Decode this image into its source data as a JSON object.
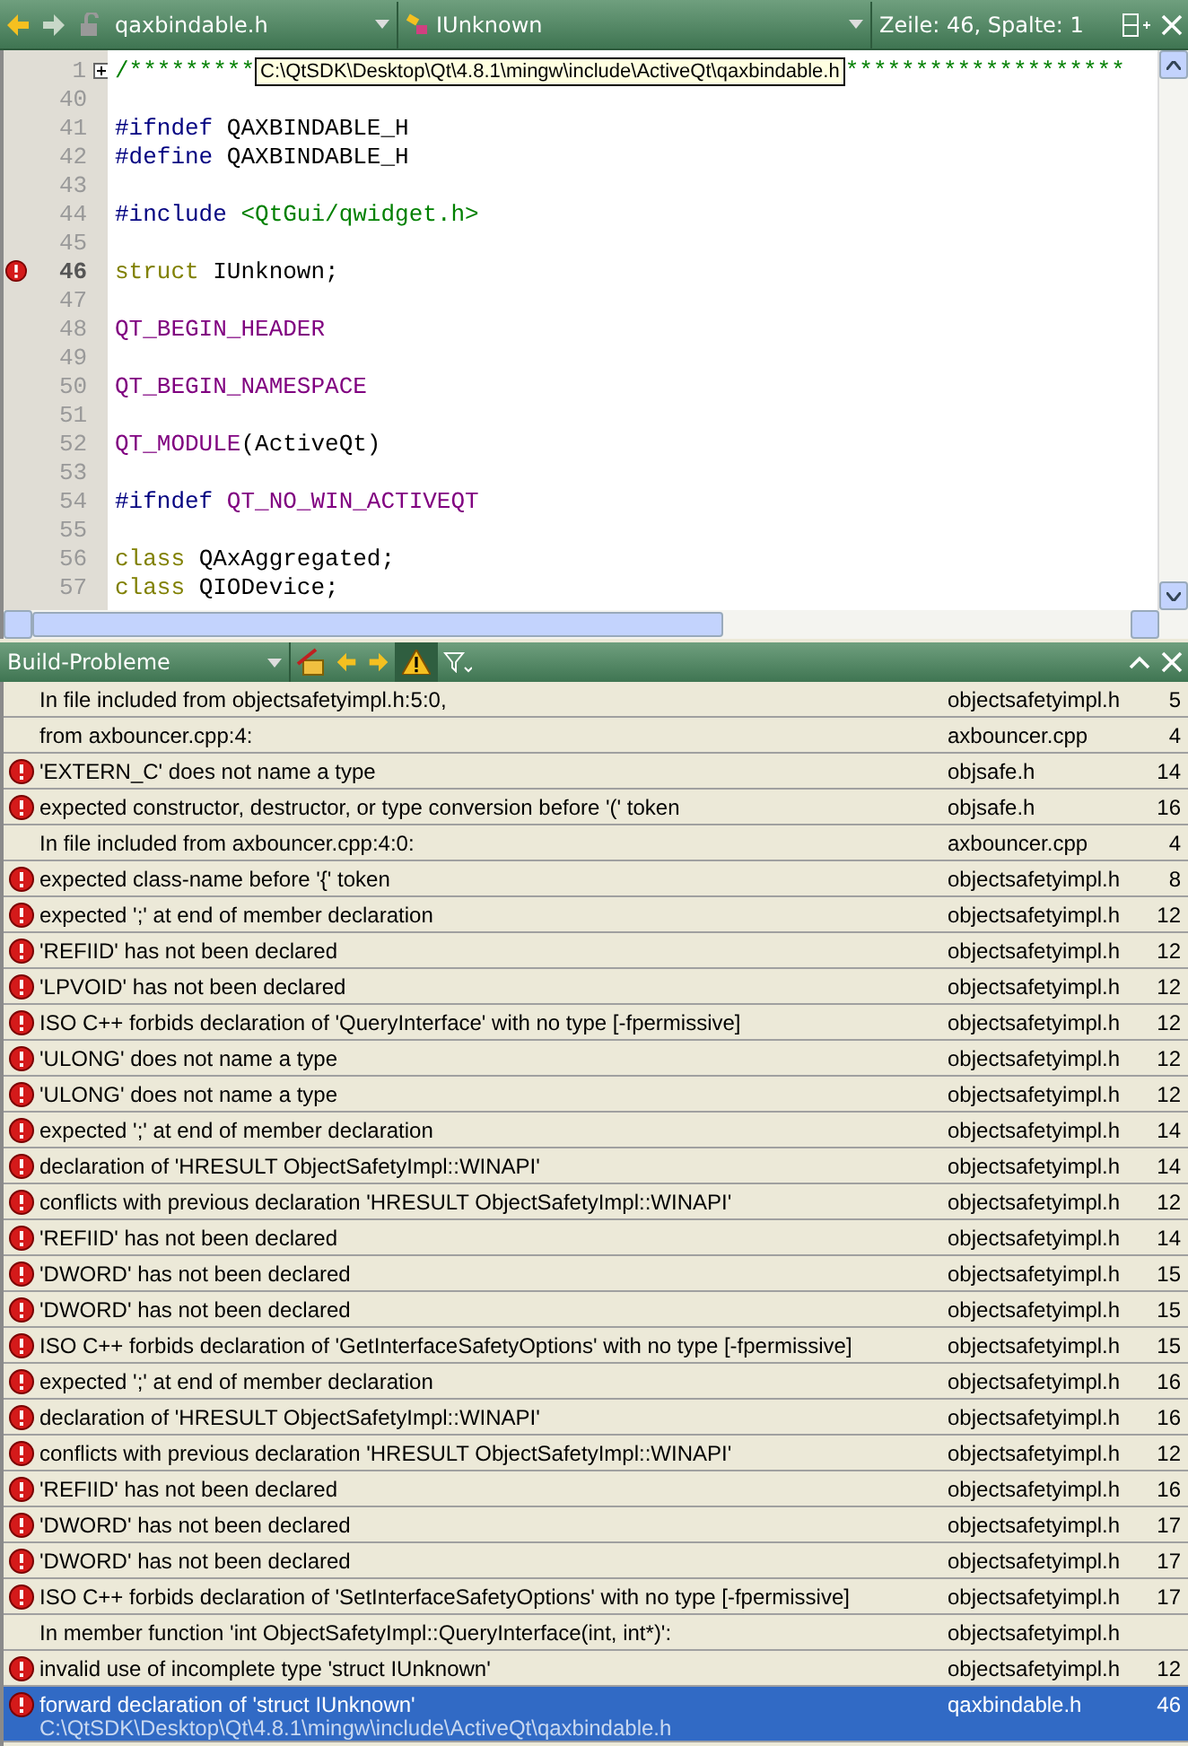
{
  "editor_toolbar": {
    "file": "qaxbindable.h",
    "symbol": "IUnknown",
    "position": "Zeile: 46, Spalte: 1"
  },
  "tooltip": "C:\\QtSDK\\Desktop\\Qt\\4.8.1\\mingw\\include\\ActiveQt\\qaxbindable.h",
  "code_lines": [
    {
      "number": "1",
      "fold": true,
      "tokens": [
        {
          "kind": "comment",
          "text": "/*********"
        }
      ],
      "tail": "********************"
    },
    {
      "number": "40"
    },
    {
      "number": "41",
      "tokens": [
        {
          "kind": "preprocessor",
          "text": "#ifndef"
        },
        {
          "kind": "plain",
          "text": " QAXBINDABLE_H"
        }
      ]
    },
    {
      "number": "42",
      "tokens": [
        {
          "kind": "preprocessor",
          "text": "#define"
        },
        {
          "kind": "plain",
          "text": " QAXBINDABLE_H"
        }
      ]
    },
    {
      "number": "43"
    },
    {
      "number": "44",
      "tokens": [
        {
          "kind": "preprocessor",
          "text": "#include"
        },
        {
          "kind": "string",
          "text": " <QtGui/qwidget.h>"
        }
      ]
    },
    {
      "number": "45"
    },
    {
      "number": "46",
      "error": true,
      "tokens": [
        {
          "kind": "keyword",
          "text": "struct"
        },
        {
          "kind": "plain",
          "text": " IUnknown;"
        }
      ]
    },
    {
      "number": "47"
    },
    {
      "number": "48",
      "tokens": [
        {
          "kind": "macro",
          "text": "QT_BEGIN_HEADER"
        }
      ]
    },
    {
      "number": "49"
    },
    {
      "number": "50",
      "tokens": [
        {
          "kind": "macro",
          "text": "QT_BEGIN_NAMESPACE"
        }
      ]
    },
    {
      "number": "51"
    },
    {
      "number": "52",
      "tokens": [
        {
          "kind": "macro",
          "text": "QT_MODULE"
        },
        {
          "kind": "plain",
          "text": "(ActiveQt)"
        }
      ]
    },
    {
      "number": "53"
    },
    {
      "number": "54",
      "tokens": [
        {
          "kind": "preprocessor",
          "text": "#ifndef"
        },
        {
          "kind": "macro",
          "text": " QT_NO_WIN_ACTIVEQT"
        }
      ]
    },
    {
      "number": "55"
    },
    {
      "number": "56",
      "tokens": [
        {
          "kind": "keyword",
          "text": "class"
        },
        {
          "kind": "plain",
          "text": " QAxAggregated;"
        }
      ]
    },
    {
      "number": "57",
      "tokens": [
        {
          "kind": "keyword",
          "text": "class"
        },
        {
          "kind": "plain",
          "text": " QIODevice;"
        }
      ]
    }
  ],
  "issues_panel": {
    "title": "Build-Probleme",
    "warnings_filter_on": true
  },
  "issues": [
    {
      "kind": "info",
      "message": "In file included from objectsafetyimpl.h:5:0,",
      "file": "objectsafetyimpl.h",
      "line": "5",
      "selected": false
    },
    {
      "kind": "info",
      "message": "from axbouncer.cpp:4:",
      "file": "axbouncer.cpp",
      "line": "4",
      "selected": false
    },
    {
      "kind": "error",
      "message": "'EXTERN_C' does not name a type",
      "file": "objsafe.h",
      "line": "14",
      "selected": false
    },
    {
      "kind": "error",
      "message": "expected constructor, destructor, or type conversion before '(' token",
      "file": "objsafe.h",
      "line": "16",
      "selected": false
    },
    {
      "kind": "info",
      "message": "In file included from axbouncer.cpp:4:0:",
      "file": "axbouncer.cpp",
      "line": "4",
      "selected": false
    },
    {
      "kind": "error",
      "message": "expected class-name before '{' token",
      "file": "objectsafetyimpl.h",
      "line": "8",
      "selected": false
    },
    {
      "kind": "error",
      "message": "expected ';' at end of member declaration",
      "file": "objectsafetyimpl.h",
      "line": "12",
      "selected": false
    },
    {
      "kind": "error",
      "message": "'REFIID' has not been declared",
      "file": "objectsafetyimpl.h",
      "line": "12",
      "selected": false
    },
    {
      "kind": "error",
      "message": "'LPVOID' has not been declared",
      "file": "objectsafetyimpl.h",
      "line": "12",
      "selected": false
    },
    {
      "kind": "error",
      "message": "ISO C++ forbids declaration of 'QueryInterface' with no type [-fpermissive]",
      "file": "objectsafetyimpl.h",
      "line": "12",
      "selected": false
    },
    {
      "kind": "error",
      "message": "'ULONG' does not name a type",
      "file": "objectsafetyimpl.h",
      "line": "12",
      "selected": false
    },
    {
      "kind": "error",
      "message": "'ULONG' does not name a type",
      "file": "objectsafetyimpl.h",
      "line": "12",
      "selected": false
    },
    {
      "kind": "error",
      "message": "expected ';' at end of member declaration",
      "file": "objectsafetyimpl.h",
      "line": "14",
      "selected": false
    },
    {
      "kind": "error",
      "message": "declaration of 'HRESULT ObjectSafetyImpl::WINAPI'",
      "file": "objectsafetyimpl.h",
      "line": "14",
      "selected": false
    },
    {
      "kind": "error",
      "message": "conflicts with previous declaration 'HRESULT ObjectSafetyImpl::WINAPI'",
      "file": "objectsafetyimpl.h",
      "line": "12",
      "selected": false
    },
    {
      "kind": "error",
      "message": "'REFIID' has not been declared",
      "file": "objectsafetyimpl.h",
      "line": "14",
      "selected": false
    },
    {
      "kind": "error",
      "message": "'DWORD' has not been declared",
      "file": "objectsafetyimpl.h",
      "line": "15",
      "selected": false
    },
    {
      "kind": "error",
      "message": "'DWORD' has not been declared",
      "file": "objectsafetyimpl.h",
      "line": "15",
      "selected": false
    },
    {
      "kind": "error",
      "message": "ISO C++ forbids declaration of 'GetInterfaceSafetyOptions' with no type [-fpermissive]",
      "file": "objectsafetyimpl.h",
      "line": "15",
      "selected": false
    },
    {
      "kind": "error",
      "message": "expected ';' at end of member declaration",
      "file": "objectsafetyimpl.h",
      "line": "16",
      "selected": false
    },
    {
      "kind": "error",
      "message": "declaration of 'HRESULT ObjectSafetyImpl::WINAPI'",
      "file": "objectsafetyimpl.h",
      "line": "16",
      "selected": false
    },
    {
      "kind": "error",
      "message": "conflicts with previous declaration 'HRESULT ObjectSafetyImpl::WINAPI'",
      "file": "objectsafetyimpl.h",
      "line": "12",
      "selected": false
    },
    {
      "kind": "error",
      "message": "'REFIID' has not been declared",
      "file": "objectsafetyimpl.h",
      "line": "16",
      "selected": false
    },
    {
      "kind": "error",
      "message": "'DWORD' has not been declared",
      "file": "objectsafetyimpl.h",
      "line": "17",
      "selected": false
    },
    {
      "kind": "error",
      "message": "'DWORD' has not been declared",
      "file": "objectsafetyimpl.h",
      "line": "17",
      "selected": false
    },
    {
      "kind": "error",
      "message": "ISO C++ forbids declaration of 'SetInterfaceSafetyOptions' with no type [-fpermissive]",
      "file": "objectsafetyimpl.h",
      "line": "17",
      "selected": false
    },
    {
      "kind": "info",
      "message": "In member function 'int ObjectSafetyImpl::QueryInterface(int, int*)':",
      "file": "objectsafetyimpl.h",
      "selected": false
    },
    {
      "kind": "error",
      "message": "invalid use of incomplete type 'struct IUnknown'",
      "file": "objectsafetyimpl.h",
      "line": "12",
      "selected": false
    },
    {
      "kind": "error",
      "message": "forward declaration of 'struct IUnknown'",
      "path": "C:\\QtSDK\\Desktop\\Qt\\4.8.1\\mingw\\include\\ActiveQt\\qaxbindable.h",
      "file": "qaxbindable.h",
      "line": "46",
      "selected": true
    }
  ]
}
